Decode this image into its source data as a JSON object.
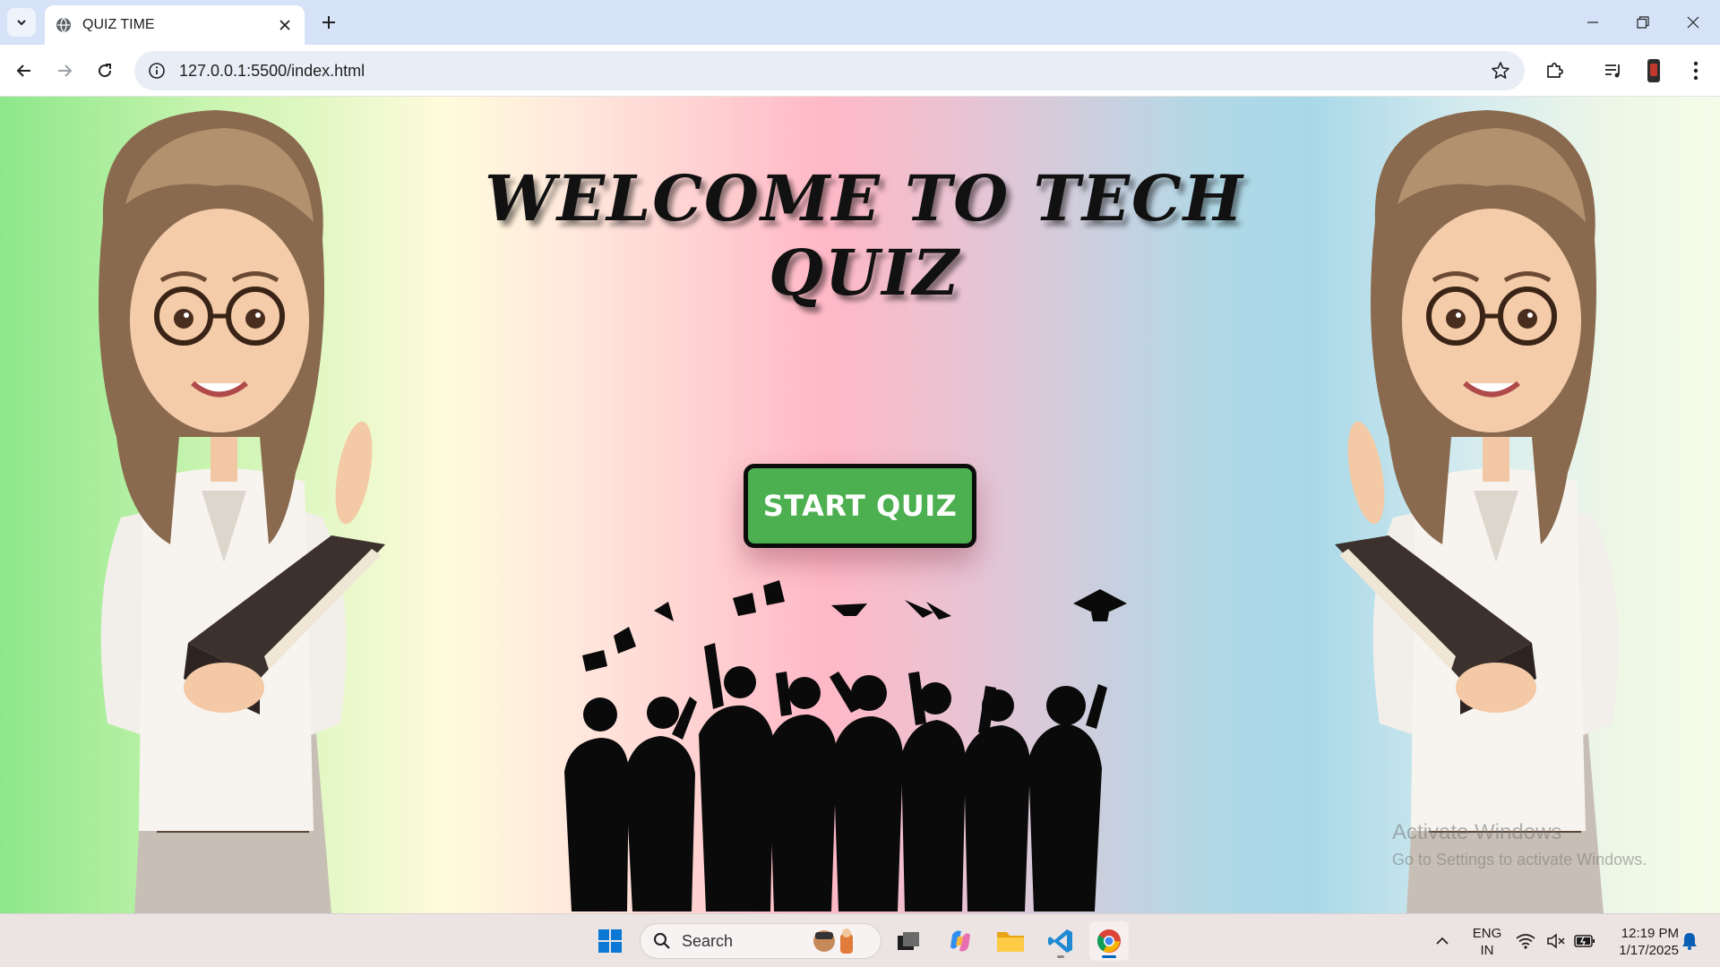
{
  "browser": {
    "tab_title": "QUIZ TIME",
    "url": "127.0.0.1:5500/index.html"
  },
  "page": {
    "heading": "WELCOME TO TECH QUIZ",
    "start_button": "START QUIZ",
    "watermark_line1": "Activate Windows",
    "watermark_line2": "Go to Settings to activate Windows."
  },
  "taskbar": {
    "search_placeholder": "Search",
    "language_line1": "ENG",
    "language_line2": "IN",
    "time": "12:19 PM",
    "date": "1/17/2025"
  },
  "colors": {
    "start_button_bg": "#4caf50",
    "accent": "#0067c0"
  }
}
